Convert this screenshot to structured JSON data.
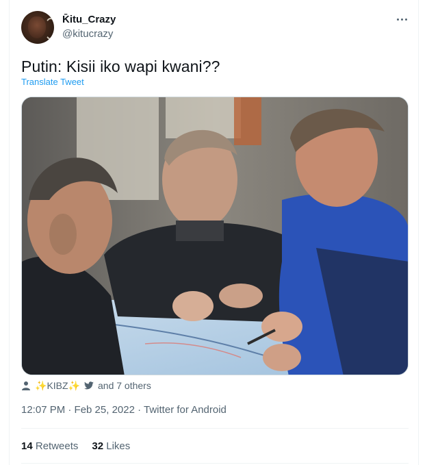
{
  "tweet": {
    "display_name": "K̄itu_Crazy",
    "handle": "@kitucrazy",
    "text": "Putin: Kisii iko wapi kwani??",
    "translate_label": "Translate Tweet",
    "timestamp": "12:07 PM · Feb 25, 2022",
    "source": "Twitter for Android",
    "likers": {
      "name": "KIBZ",
      "sparkle": "✨",
      "suffix": "and 7 others"
    },
    "stats": {
      "retweets_count": "14",
      "retweets_label": "Retweets",
      "likes_count": "32",
      "likes_label": "Likes"
    }
  },
  "icons": {
    "more": "more-dots-icon",
    "person": "person-icon",
    "bird": "twitter-bird-icon"
  },
  "colors": {
    "link": "#1d9bf0",
    "secondary_text": "#536471",
    "primary_text": "#0f1419"
  }
}
